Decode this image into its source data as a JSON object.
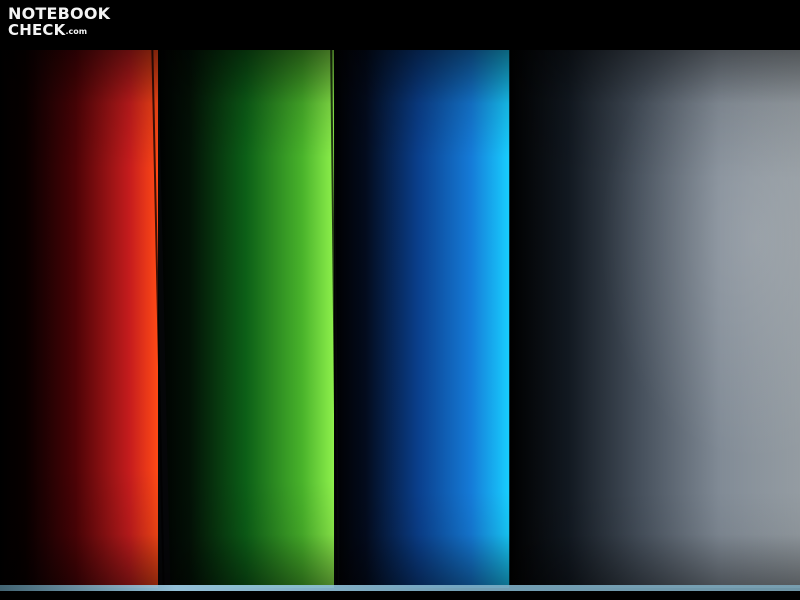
{
  "logo": {
    "top": "NOTEBOOK",
    "bottom": "CHECK",
    "suffix": ".com"
  },
  "colors": {
    "red": "#ff4a16",
    "green": "#8ef04c",
    "blue": "#18d0ff",
    "gray": "#a8b1b8",
    "background": "#000000"
  }
}
